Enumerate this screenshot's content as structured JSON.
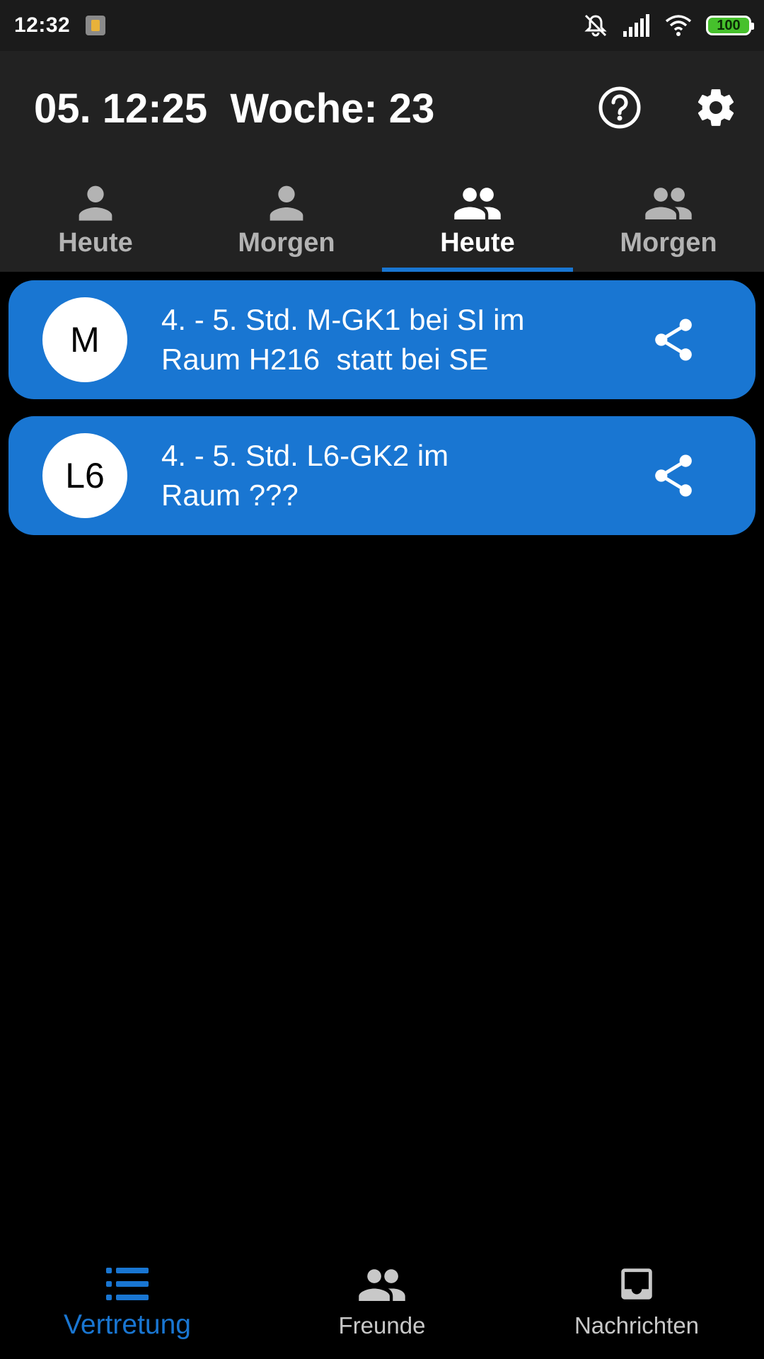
{
  "status_bar": {
    "time": "12:32",
    "battery": "100",
    "icons": [
      "notification-icon",
      "mute-icon",
      "signal-icon",
      "wifi-icon",
      "battery-icon"
    ]
  },
  "app_bar": {
    "title": "05. 12:25  Woche: 23",
    "actions": [
      "help-icon",
      "settings-icon"
    ]
  },
  "tabs": [
    {
      "label": "Heute",
      "icon": "person-icon",
      "active": false
    },
    {
      "label": "Morgen",
      "icon": "person-icon",
      "active": false
    },
    {
      "label": "Heute",
      "icon": "group-icon",
      "active": true
    },
    {
      "label": "Morgen",
      "icon": "group-icon",
      "active": false
    }
  ],
  "cards": [
    {
      "badge": "M",
      "text": "4. - 5. Std. M-GK1 bei SI im\nRaum H216  statt bei SE",
      "action_icon": "share-icon"
    },
    {
      "badge": "L6",
      "text": "4. - 5. Std. L6-GK2 im\nRaum ???",
      "action_icon": "share-icon"
    }
  ],
  "bottom_nav": [
    {
      "label": "Vertretung",
      "icon": "list-icon",
      "active": true
    },
    {
      "label": "Freunde",
      "icon": "group-icon",
      "active": false
    },
    {
      "label": "Nachrichten",
      "icon": "inbox-icon",
      "active": false
    }
  ],
  "colors": {
    "accent": "#1976d2",
    "app_bar_bg": "#222222",
    "status_bar_bg": "#1b1b1b",
    "background": "#000000",
    "battery_fill": "#46c12c"
  }
}
